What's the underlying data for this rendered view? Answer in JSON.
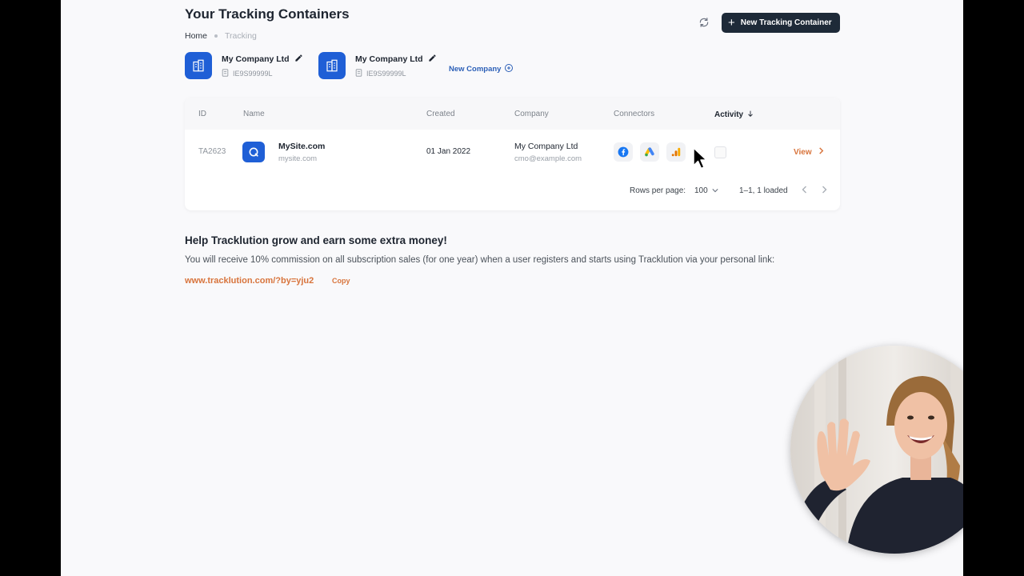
{
  "header": {
    "title": "Your Tracking Containers",
    "new_button_label": "New Tracking Container"
  },
  "breadcrumb": {
    "home": "Home",
    "current": "Tracking"
  },
  "companies": [
    {
      "name": "My Company Ltd",
      "vat": "IE9S99999L"
    },
    {
      "name": "My Company Ltd",
      "vat": "IE9S99999L"
    }
  ],
  "new_company_label": "New Company",
  "table": {
    "columns": {
      "id": "ID",
      "name": "Name",
      "created": "Created",
      "company": "Company",
      "connectors": "Connectors",
      "activity": "Activity"
    },
    "rows": [
      {
        "id": "TA2623",
        "site_name": "MySite.com",
        "site_domain": "mysite.com",
        "created": "01 Jan 2022",
        "company": "My Company Ltd",
        "email": "cmo@example.com",
        "connectors": [
          "facebook-icon",
          "google-ads-icon",
          "google-analytics-icon"
        ],
        "action": "View"
      }
    ],
    "footer": {
      "rows_per_page_label": "Rows per page:",
      "rows_per_page_value": "100",
      "range": "1–1, 1 loaded"
    }
  },
  "affiliate": {
    "title": "Help Tracklution grow and earn some extra money!",
    "text": "You will receive 10% commission on all subscription sales (for one year) when a user registers and starts using Tracklution via your personal link:",
    "link": "www.tracklution.com/?by=yju2",
    "copy_label": "Copy"
  },
  "colors": {
    "primary_dark": "#1e2a38",
    "brand_blue": "#1f5fd6",
    "accent_orange": "#d8743c",
    "link_blue": "#2b5fb7"
  }
}
